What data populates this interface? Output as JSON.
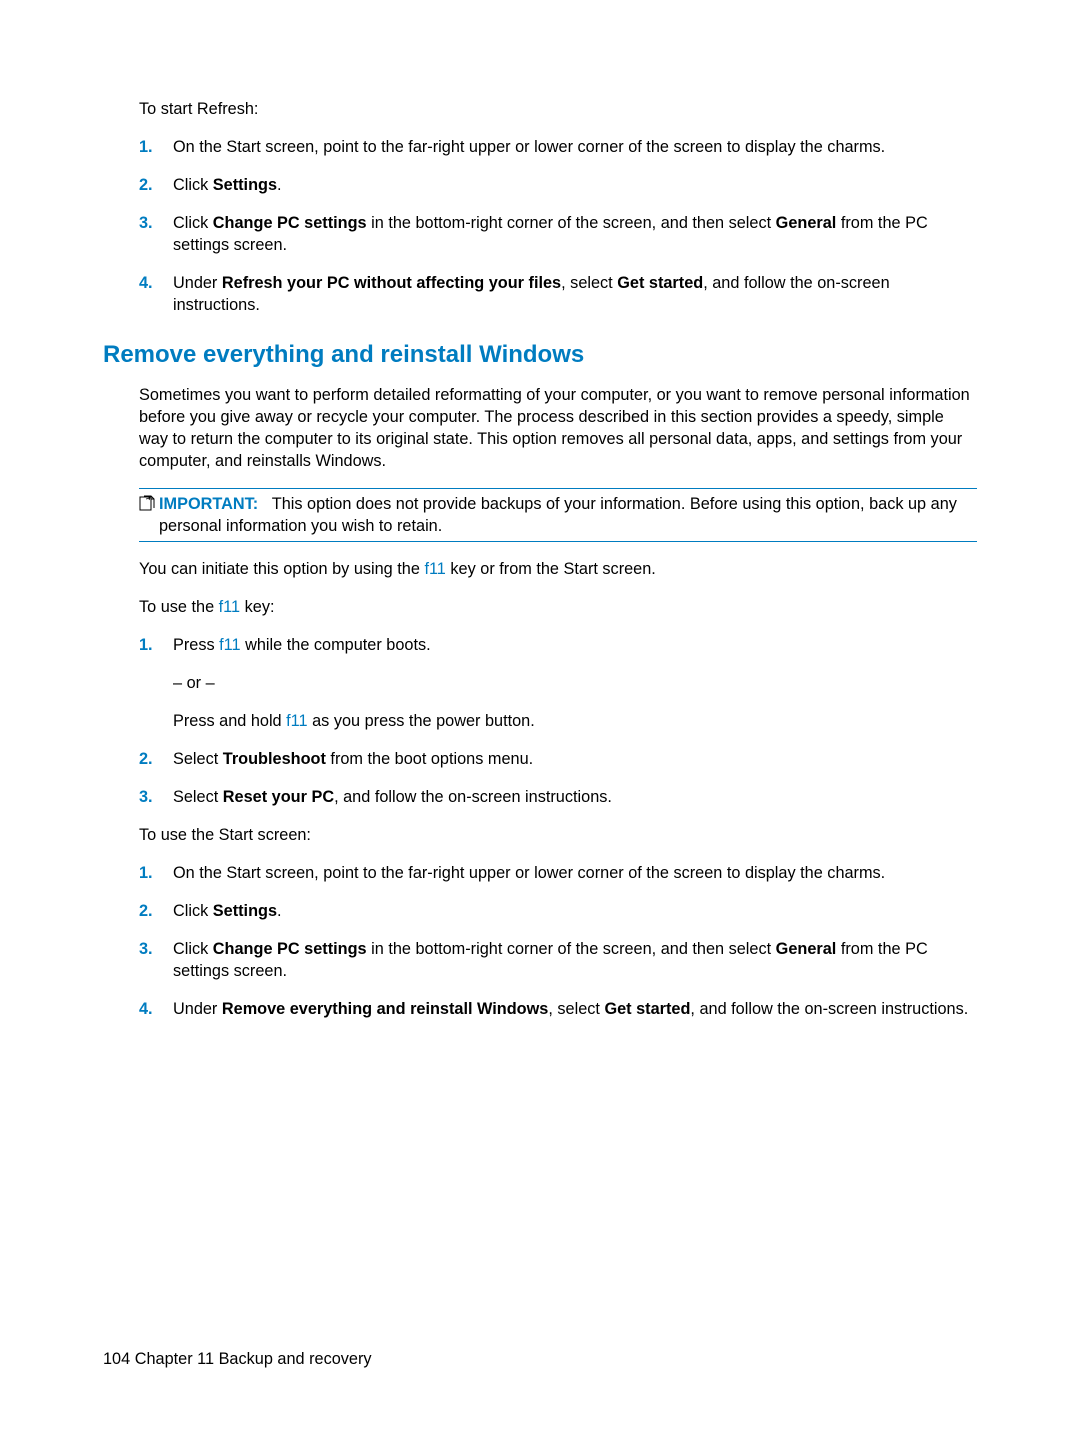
{
  "intro1": "To start Refresh:",
  "listA": {
    "i1": {
      "n": "1.",
      "text": "On the Start screen, point to the far-right upper or lower corner of the screen to display the charms."
    },
    "i2": {
      "n": "2.",
      "pre": "Click ",
      "bold": "Settings",
      "post": "."
    },
    "i3": {
      "n": "3.",
      "pre": "Click ",
      "bold1": "Change PC settings",
      "mid": " in the bottom-right corner of the screen, and then select ",
      "bold2": "General",
      "post": " from the PC settings screen."
    },
    "i4": {
      "n": "4.",
      "pre": "Under ",
      "bold1": "Refresh your PC without affecting your files",
      "mid": ", select ",
      "bold2": "Get started",
      "post": ", and follow the on-screen instructions."
    }
  },
  "heading": "Remove everything and reinstall Windows",
  "para1": "Sometimes you want to perform detailed reformatting of your computer, or you want to remove personal information before you give away or recycle your computer. The process described in this section provides a speedy, simple way to return the computer to its original state. This option removes all personal data, apps, and settings from your computer, and reinstalls Windows.",
  "important": {
    "label": "IMPORTANT:",
    "text": "This option does not provide backups of your information. Before using this option, back up any personal information you wish to retain."
  },
  "para2": {
    "pre": "You can initiate this option by using the ",
    "key": "f11",
    "post": " key or from the Start screen."
  },
  "para3": {
    "pre": "To use the ",
    "key": "f11",
    "post": " key:"
  },
  "listB": {
    "i1": {
      "n": "1.",
      "l1pre": "Press ",
      "l1key": "f11",
      "l1post": " while the computer boots.",
      "l2": "– or –",
      "l3pre": "Press and hold ",
      "l3key": "f11",
      "l3post": " as you press the power button."
    },
    "i2": {
      "n": "2.",
      "pre": "Select ",
      "bold": "Troubleshoot",
      "post": " from the boot options menu."
    },
    "i3": {
      "n": "3.",
      "pre": "Select ",
      "bold": "Reset your PC",
      "post": ", and follow the on-screen instructions."
    }
  },
  "para4": "To use the Start screen:",
  "listC": {
    "i1": {
      "n": "1.",
      "text": "On the Start screen, point to the far-right upper or lower corner of the screen to display the charms."
    },
    "i2": {
      "n": "2.",
      "pre": "Click ",
      "bold": "Settings",
      "post": "."
    },
    "i3": {
      "n": "3.",
      "pre": "Click ",
      "bold1": "Change PC settings",
      "mid": " in the bottom-right corner of the screen, and then select ",
      "bold2": "General",
      "post": " from the PC settings screen."
    },
    "i4": {
      "n": "4.",
      "pre": "Under ",
      "bold1": "Remove everything and reinstall Windows",
      "mid": ", select ",
      "bold2": "Get started",
      "post": ", and follow the on-screen instructions."
    }
  },
  "footer": {
    "page": "104",
    "sep": "  ",
    "chapter": "Chapter 11   Backup and recovery"
  }
}
